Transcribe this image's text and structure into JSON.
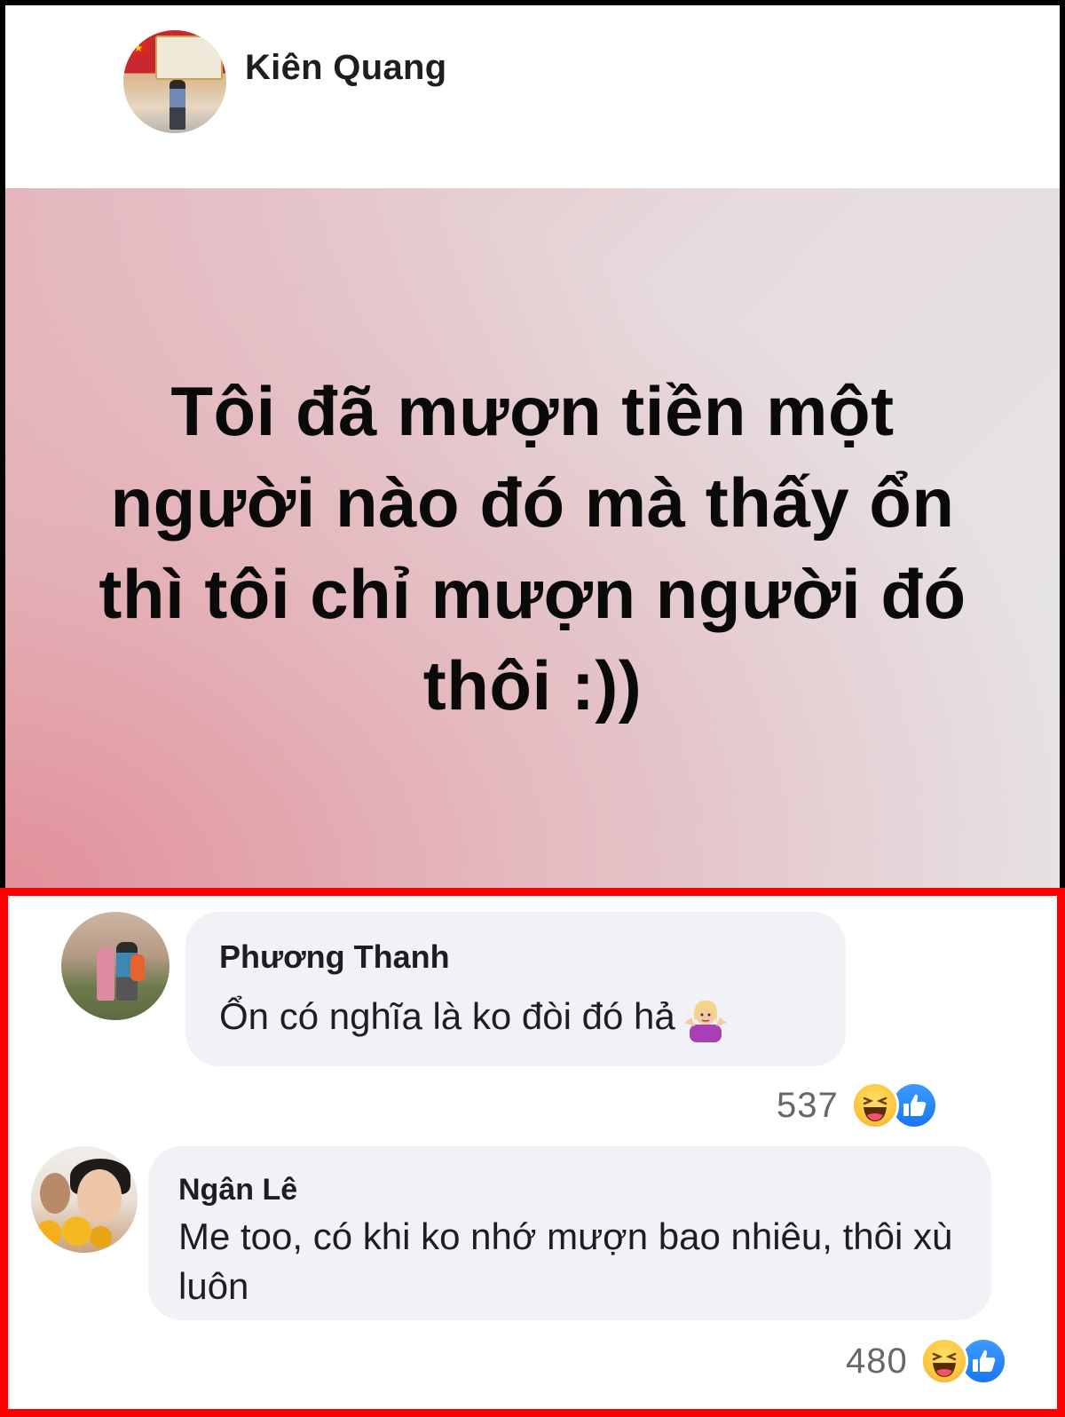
{
  "post": {
    "author": "Kiên Quang",
    "image_text": "Tôi đã mượn tiền một người nào đó mà thấy ổn thì tôi chỉ mượn người đó thôi :))"
  },
  "comments": [
    {
      "name": "Phương Thanh",
      "text": "Ổn có nghĩa là ko đòi đó hả",
      "emoji": "woman-shrugging",
      "reaction_count": "537",
      "reaction_icons": [
        "haha-icon",
        "like-icon"
      ]
    },
    {
      "name": "Ngân Lê",
      "text": "Me too, có khi ko nhớ mượn bao nhiêu, thôi xù luôn",
      "reaction_count": "480",
      "reaction_icons": [
        "haha-icon",
        "like-icon"
      ]
    }
  ],
  "colors": {
    "highlight_border": "#ff0000",
    "bubble_bg": "#f0f2f5",
    "like_blue": "#1877f2",
    "haha_yellow": "#fcc640"
  }
}
